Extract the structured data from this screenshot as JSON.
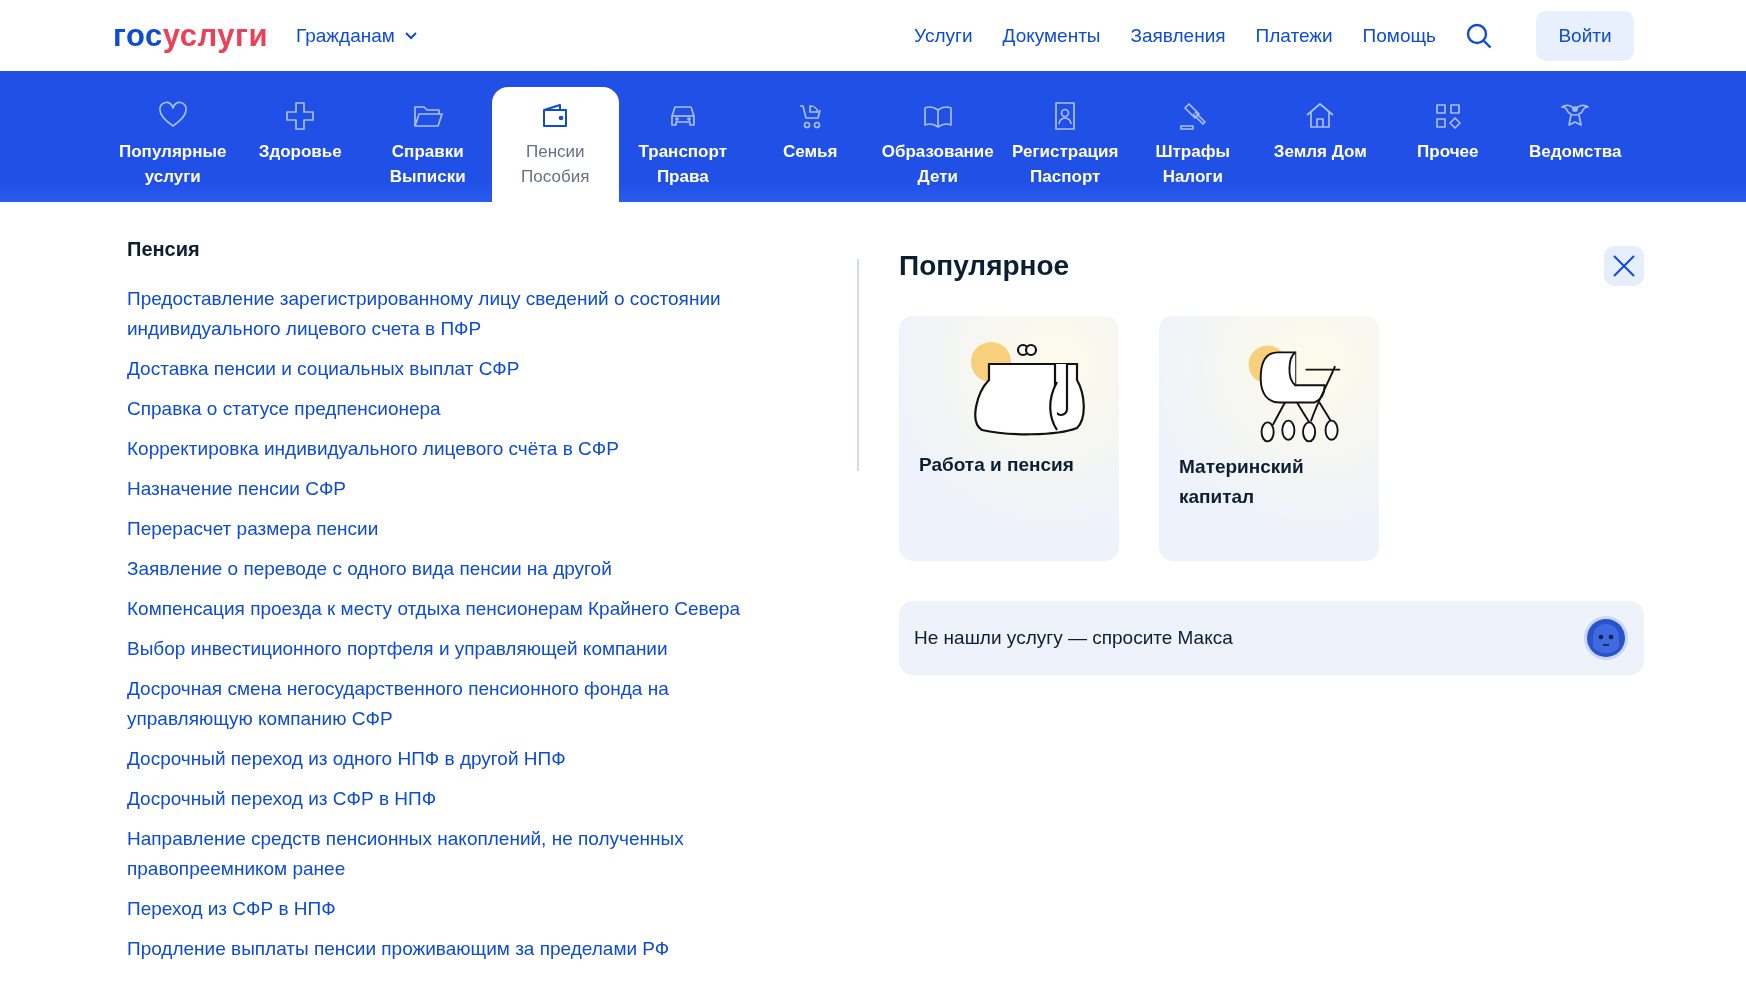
{
  "header": {
    "logo": {
      "part_1": "гос",
      "part_2": "услуги"
    },
    "audience_menu": "Гражданам",
    "nav": [
      "Услуги",
      "Документы",
      "Заявления",
      "Платежи",
      "Помощь"
    ],
    "login_button": "Войти"
  },
  "categories": [
    {
      "label": "Популярные\nуслуги",
      "selected": false
    },
    {
      "label": "Здоровье",
      "selected": false
    },
    {
      "label": "Справки\nВыписки",
      "selected": false
    },
    {
      "label": "Пенсии\nПособия",
      "selected": true
    },
    {
      "label": "Транспорт\nПрава",
      "selected": false
    },
    {
      "label": "Семья",
      "selected": false
    },
    {
      "label": "Образование\nДети",
      "selected": false
    },
    {
      "label": "Регистрация\nПаспорт",
      "selected": false
    },
    {
      "label": "Штрафы\nНалоги",
      "selected": false
    },
    {
      "label": "Земля Дом",
      "selected": false
    },
    {
      "label": "Прочее",
      "selected": false
    },
    {
      "label": "Ведомства",
      "selected": false
    }
  ],
  "section": {
    "title": "Пенсия",
    "links": [
      "Предоставление зарегистрированному лицу сведений о состоянии индивидуального лицевого счета в ПФР",
      "Доставка пенсии и социальных выплат СФР",
      "Справка о статусе предпенсионера",
      "Корректировка индивидуального лицевого счёта в СФР",
      "Назначение пенсии СФР",
      "Перерасчет размера пенсии",
      "Заявление о переводе с одного вида пенсии на другой",
      "Компенсация проезда к месту отдыха пенсионерам Крайнего Севера",
      "Выбор инвестиционного портфеля и управляющей компании",
      "Досрочная смена негосударственного пенсионного фонда на управляющую компанию СФР",
      "Досрочный переход из одного НПФ в другой НПФ",
      "Досрочный переход из СФР в НПФ",
      "Направление средств пенсионных накоплений, не полученных правопреемником ранее",
      "Переход из СФР в НПФ",
      "Продление выплаты пенсии проживающим за пределами РФ"
    ]
  },
  "popular": {
    "title": "Популярное",
    "cards": [
      {
        "title": "Работа и пенсия"
      },
      {
        "title": "Материнский капитал"
      }
    ],
    "ask": "Не нашли услугу — спросите Макса"
  }
}
